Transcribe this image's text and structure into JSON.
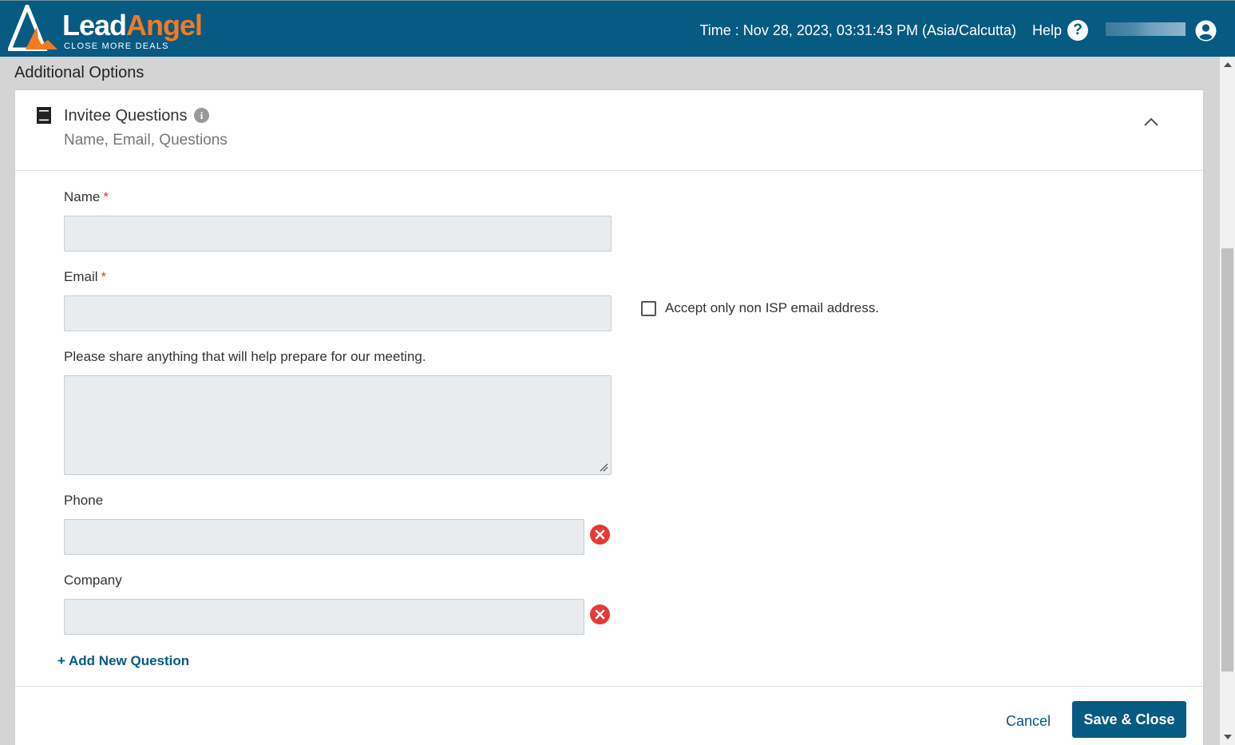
{
  "header": {
    "logo_lead": "Lead",
    "logo_angel": "Angel",
    "logo_tagline": "CLOSE MORE DEALS",
    "clock_text": "Time : Nov 28, 2023, 03:31:43 PM (Asia/Calcutta)",
    "help_label": "Help",
    "help_icon": "?"
  },
  "page": {
    "section_title": "Additional Options"
  },
  "card": {
    "title": "Invitee Questions",
    "info_icon": "i",
    "subtitle": "Name, Email, Questions"
  },
  "form": {
    "name_label": "Name",
    "email_label": "Email",
    "required_mark": "*",
    "non_isp_label": "Accept only non ISP email address.",
    "question_label": "Please share anything that will help prepare for our meeting.",
    "phone_label": "Phone",
    "company_label": "Company",
    "add_question": "+ Add New Question"
  },
  "footer": {
    "cancel_label": "Cancel",
    "save_label": "Save & Close"
  },
  "colors": {
    "brand_blue": "#075a82",
    "brand_orange": "#f47a20",
    "remove_red": "#e53935"
  }
}
